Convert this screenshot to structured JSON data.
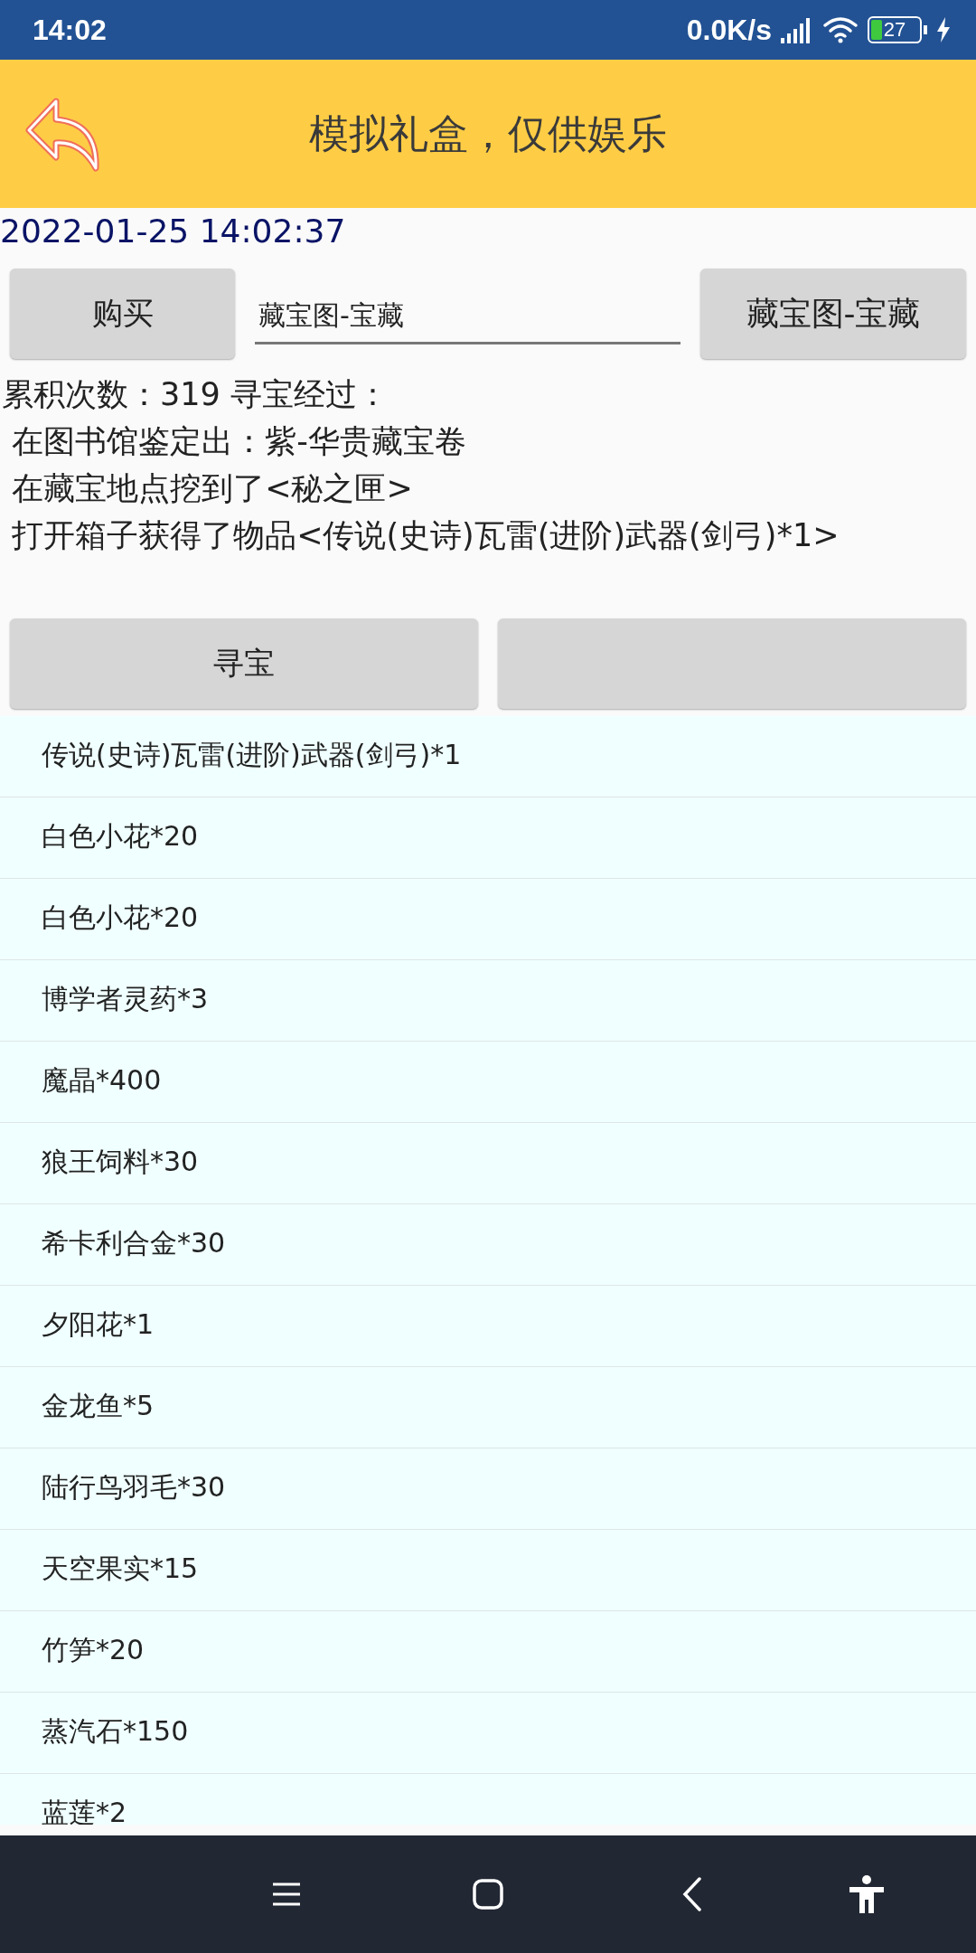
{
  "status_bar": {
    "time": "14:02",
    "net_speed": "0.0K/s",
    "battery": "27"
  },
  "header": {
    "title": "模拟礼盒，仅供娱乐"
  },
  "timestamp": "2022-01-25 14:02:37",
  "buy_button": "购买",
  "item_field": {
    "value": "藏宝图-宝藏"
  },
  "item_button": "藏宝图-宝藏",
  "log_lines": [
    "累积次数：319 寻宝经过：",
    " 在图书馆鉴定出：紫-华贵藏宝卷",
    " 在藏宝地点挖到了<秘之匣>",
    " 打开箱子获得了物品<传说(史诗)瓦雷(进阶)武器(剑弓)*1>"
  ],
  "action_buttons": [
    {
      "kind": "text",
      "label": "寻宝"
    },
    {
      "kind": "blank"
    }
  ],
  "items": [
    "传说(史诗)瓦雷(进阶)武器(剑弓)*1",
    "白色小花*20",
    "白色小花*20",
    "博学者灵药*3",
    "魔晶*400",
    "狼王饲料*30",
    "希卡利合金*30",
    "夕阳花*1",
    "金龙鱼*5",
    "陆行鸟羽毛*30",
    "天空果实*15",
    "竹笋*20",
    "蒸汽石*150",
    "蓝莲*2"
  ]
}
